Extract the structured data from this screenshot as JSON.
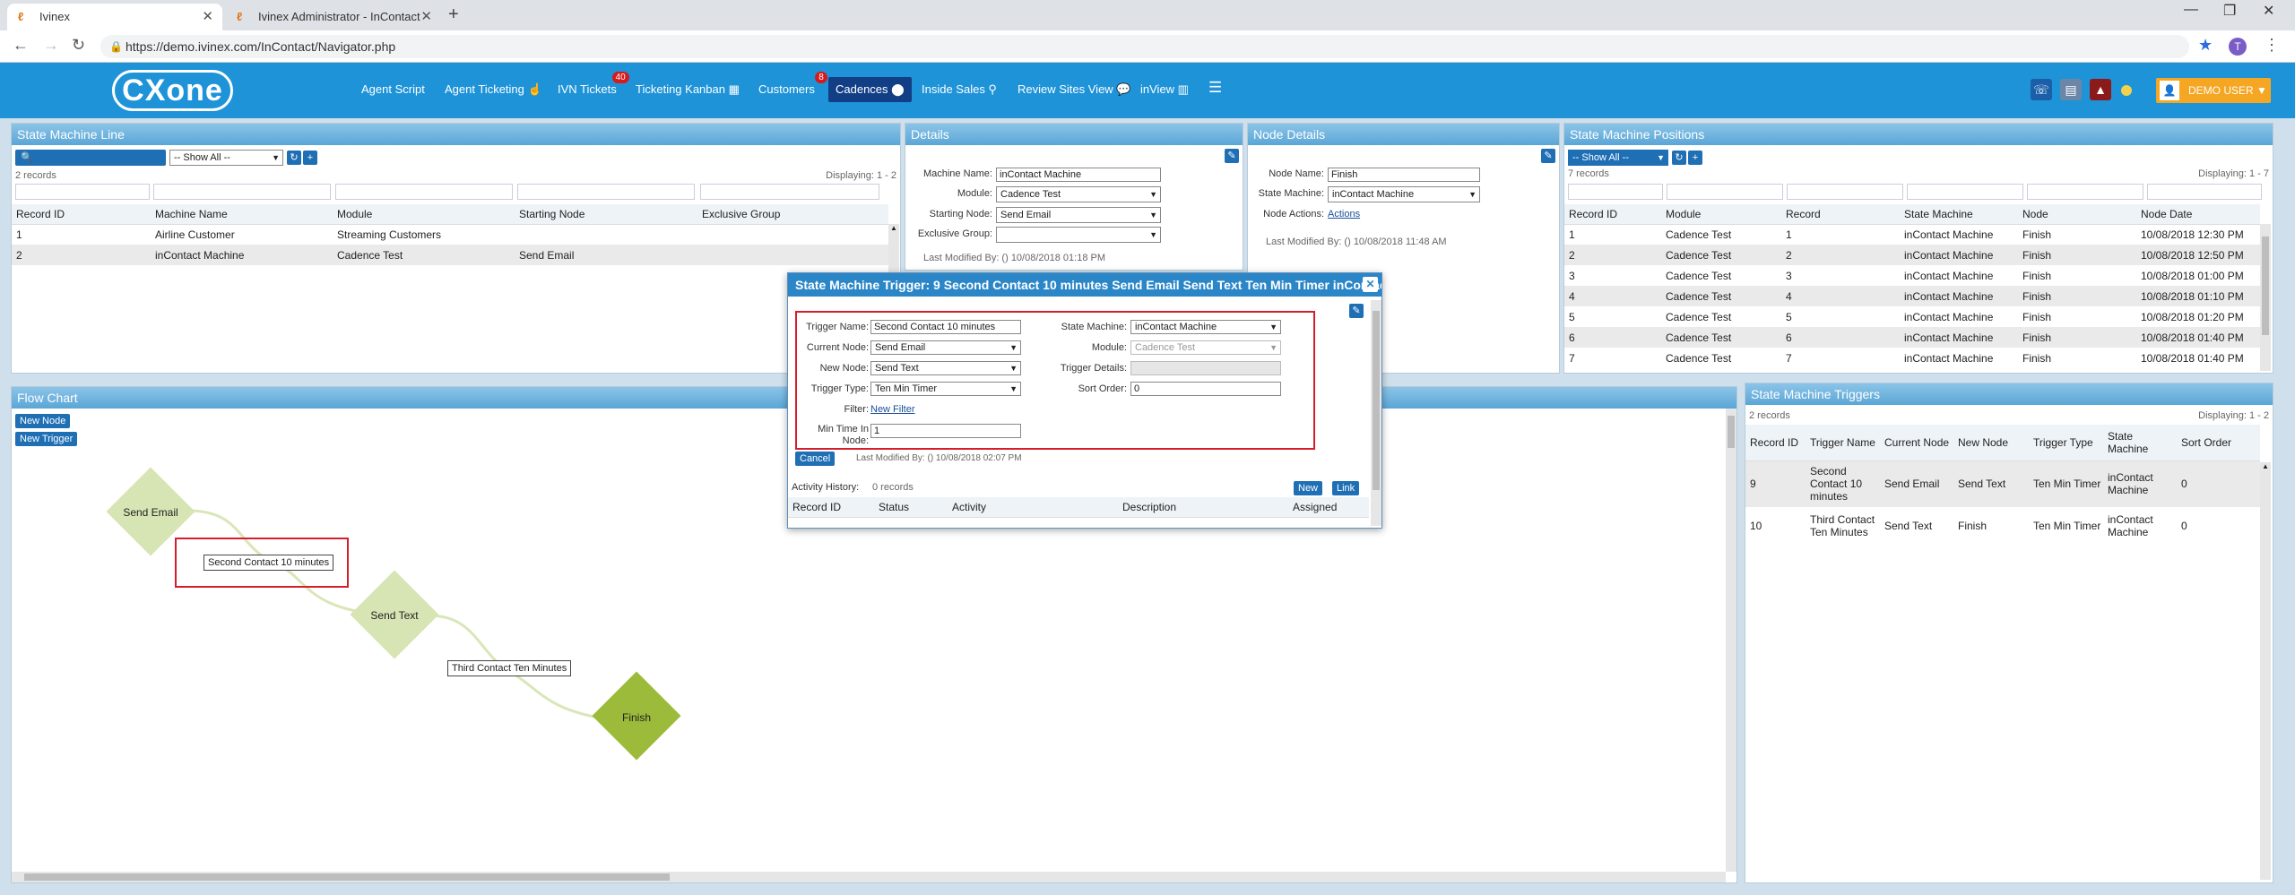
{
  "browser": {
    "tabs": [
      {
        "title": "Ivinex",
        "active": true
      },
      {
        "title": "Ivinex Administrator - InContact",
        "active": false
      }
    ],
    "url": "https://demo.ivinex.com/InContact/Navigator.php",
    "profile_initial": "T"
  },
  "header": {
    "logo": "CXone",
    "nav": [
      {
        "label": "Agent Script"
      },
      {
        "label": "Agent Ticketing ☝"
      },
      {
        "label": "IVN Tickets",
        "badge": "40"
      },
      {
        "label": "Ticketing Kanban ▦"
      },
      {
        "label": "Customers",
        "badge": "8"
      },
      {
        "label": "Cadences ⬤"
      },
      {
        "label": "Inside Sales ⚲"
      },
      {
        "label": "Review Sites View 💬"
      },
      {
        "label": "inView ▥"
      },
      {
        "label": "☰"
      }
    ],
    "user": "DEMO USER ▼"
  },
  "state_machine_line": {
    "title": "State Machine Line",
    "show_all": "-- Show All --",
    "records": "2 records",
    "displaying": "Displaying: 1 - 2",
    "columns": [
      "Record ID",
      "Machine Name",
      "Module",
      "Starting Node",
      "Exclusive Group"
    ],
    "rows": [
      [
        "1",
        "Airline Customer",
        "Streaming Customers",
        "",
        ""
      ],
      [
        "2",
        "inContact Machine",
        "Cadence Test",
        "Send Email",
        ""
      ]
    ]
  },
  "details": {
    "title": "Details",
    "labels": {
      "machine_name": "Machine Name:",
      "module": "Module:",
      "starting_node": "Starting Node:",
      "exclusive_group": "Exclusive Group:"
    },
    "values": {
      "machine_name": "inContact Machine",
      "module": "Cadence Test",
      "starting_node": "Send Email",
      "exclusive_group": ""
    },
    "last_modified": "Last Modified By: () 10/08/2018 01:18 PM"
  },
  "node_details": {
    "title": "Node Details",
    "labels": {
      "node_name": "Node Name:",
      "state_machine": "State Machine:",
      "node_actions": "Node Actions:"
    },
    "values": {
      "node_name": "Finish",
      "state_machine": "inContact Machine",
      "node_actions": "Actions"
    },
    "last_modified": "Last Modified By: () 10/08/2018 11:48 AM"
  },
  "positions": {
    "title": "State Machine Positions",
    "show_all": "-- Show All --",
    "records": "7 records",
    "displaying": "Displaying: 1 - 7",
    "columns": [
      "Record ID",
      "Module",
      "Record",
      "State Machine",
      "Node",
      "Node Date"
    ],
    "rows": [
      [
        "1",
        "Cadence Test",
        "1",
        "inContact Machine",
        "Finish",
        "10/08/2018 12:30 PM"
      ],
      [
        "2",
        "Cadence Test",
        "2",
        "inContact Machine",
        "Finish",
        "10/08/2018 12:50 PM"
      ],
      [
        "3",
        "Cadence Test",
        "3",
        "inContact Machine",
        "Finish",
        "10/08/2018 01:00 PM"
      ],
      [
        "4",
        "Cadence Test",
        "4",
        "inContact Machine",
        "Finish",
        "10/08/2018 01:10 PM"
      ],
      [
        "5",
        "Cadence Test",
        "5",
        "inContact Machine",
        "Finish",
        "10/08/2018 01:20 PM"
      ],
      [
        "6",
        "Cadence Test",
        "6",
        "inContact Machine",
        "Finish",
        "10/08/2018 01:40 PM"
      ],
      [
        "7",
        "Cadence Test",
        "7",
        "inContact Machine",
        "Finish",
        "10/08/2018 01:40 PM"
      ]
    ]
  },
  "flow_chart": {
    "title": "Flow Chart",
    "new_node": "New Node",
    "new_trigger": "New Trigger",
    "nodes": {
      "send_email": "Send Email",
      "send_text": "Send Text",
      "finish": "Finish"
    },
    "triggers": {
      "t1": "Second Contact 10 minutes",
      "t2": "Third Contact Ten Minutes"
    }
  },
  "triggers_panel": {
    "title": "State Machine Triggers",
    "records": "2 records",
    "displaying": "Displaying: 1 - 2",
    "columns": [
      "Record ID",
      "Trigger Name",
      "Current Node",
      "New Node",
      "Trigger Type",
      "State Machine",
      "Sort Order"
    ],
    "rows": [
      [
        "9",
        "Second Contact 10 minutes",
        "Send Email",
        "Send Text",
        "Ten Min Timer",
        "inContact Machine",
        "0"
      ],
      [
        "10",
        "Third Contact Ten Minutes",
        "Send Text",
        "Finish",
        "Ten Min Timer",
        "inContact Machine",
        "0"
      ]
    ]
  },
  "modal": {
    "title": "State Machine Trigger: 9 Second Contact 10 minutes Send Email Send Text Ten Min Timer inContact Machine",
    "labels": {
      "trigger_name": "Trigger Name:",
      "current_node": "Current Node:",
      "new_node": "New Node:",
      "trigger_type": "Trigger Type:",
      "filter": "Filter:",
      "min_time": "Min Time In Node:",
      "state_machine": "State Machine:",
      "module": "Module:",
      "trigger_details": "Trigger Details:",
      "sort_order": "Sort Order:"
    },
    "values": {
      "trigger_name": "Second Contact 10 minutes",
      "current_node": "Send Email",
      "new_node": "Send Text",
      "trigger_type": "Ten Min Timer",
      "filter": "New Filter",
      "min_time": "1",
      "state_machine": "inContact Machine",
      "module": "Cadence Test",
      "trigger_details": "",
      "sort_order": "0"
    },
    "cancel": "Cancel",
    "last_modified": "Last Modified By: () 10/08/2018 02:07 PM",
    "activity_history": "Activity History:",
    "activity_records": "0 records",
    "new_btn": "New",
    "link_btn": "Link",
    "activity_columns": [
      "Record ID",
      "Status",
      "Activity",
      "Description",
      "Assigned"
    ]
  },
  "colors": {
    "header_blue": "#1e93d8",
    "selected_nav": "#123e86",
    "node_light": "#d7e4b3",
    "node_dark": "#9dbb3a",
    "highlight_red": "#d41f2b"
  }
}
